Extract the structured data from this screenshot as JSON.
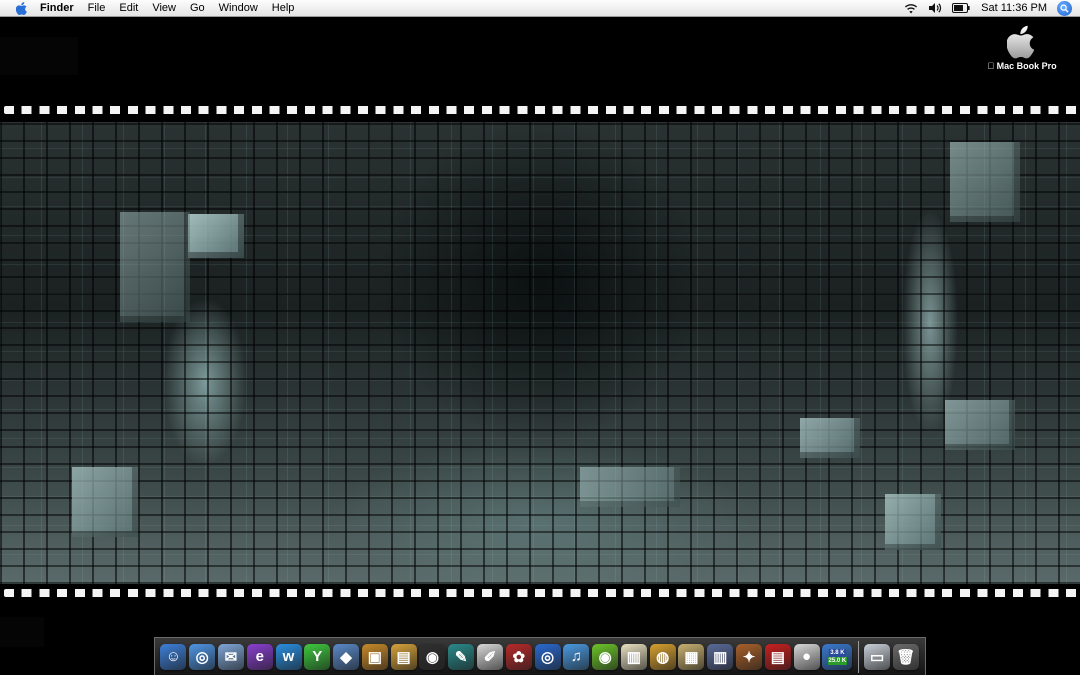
{
  "menubar": {
    "app_name": "Finder",
    "items": [
      "File",
      "Edit",
      "View",
      "Go",
      "Window",
      "Help"
    ],
    "clock": "Sat 11:36 PM",
    "icons": [
      "apple-icon",
      "wifi-icon",
      "volume-icon",
      "battery-icon",
      "spotlight-icon"
    ]
  },
  "desktop": {
    "hard_drive_label": "Mac Book Pro",
    "hard_drive_icon": "apple-logo-icon"
  },
  "dock": {
    "apps": [
      {
        "name": "finder",
        "color": "#3d7fd8",
        "glyph": "☺"
      },
      {
        "name": "safari",
        "color": "#4f96e6",
        "glyph": "◎"
      },
      {
        "name": "mail",
        "color": "#7fa6d6",
        "glyph": "✉"
      },
      {
        "name": "web-editor-e",
        "color": "#8a3fd0",
        "glyph": "e"
      },
      {
        "name": "web-editor-w",
        "color": "#2a8fe0",
        "glyph": "w"
      },
      {
        "name": "app-green-y",
        "color": "#3ec93e",
        "glyph": "Y"
      },
      {
        "name": "preview",
        "color": "#5a8ac8",
        "glyph": "◆"
      },
      {
        "name": "photo-app",
        "color": "#c88a2a",
        "glyph": "▣"
      },
      {
        "name": "iphoto",
        "color": "#d6a23a",
        "glyph": "▤"
      },
      {
        "name": "aperture",
        "color": "#303030",
        "glyph": "◉"
      },
      {
        "name": "quill-app",
        "color": "#2a8a8a",
        "glyph": "✎"
      },
      {
        "name": "text-editor",
        "color": "#d8d8d8",
        "glyph": "✐"
      },
      {
        "name": "game-app",
        "color": "#b82a2a",
        "glyph": "✿"
      },
      {
        "name": "dvd-player",
        "color": "#2a6ad0",
        "glyph": "◎"
      },
      {
        "name": "itunes",
        "color": "#4a9ae0",
        "glyph": "♫"
      },
      {
        "name": "limewire",
        "color": "#6cc42a",
        "glyph": "◉"
      },
      {
        "name": "toast",
        "color": "#e8e0c0",
        "glyph": "▥"
      },
      {
        "name": "popcorn",
        "color": "#d8a030",
        "glyph": "◍"
      },
      {
        "name": "notebook",
        "color": "#c8b070",
        "glyph": "▦"
      },
      {
        "name": "film-app",
        "color": "#5a6a9a",
        "glyph": "▥"
      },
      {
        "name": "pets-app",
        "color": "#a8602a",
        "glyph": "✦"
      },
      {
        "name": "red-app",
        "color": "#c82020",
        "glyph": "▤"
      },
      {
        "name": "apple-app",
        "color": "#d8d8d8",
        "glyph": "●"
      },
      {
        "name": "system-monitor",
        "color": "#3a7ad0",
        "glyph": "◈"
      }
    ],
    "monitor_labels": [
      "3.8 K",
      "25.0 K"
    ],
    "right": [
      {
        "name": "dock-document",
        "color": "#c8d0d8",
        "glyph": "▭"
      },
      {
        "name": "trash",
        "color": "#6a6a6a",
        "glyph": "🗑"
      }
    ]
  }
}
